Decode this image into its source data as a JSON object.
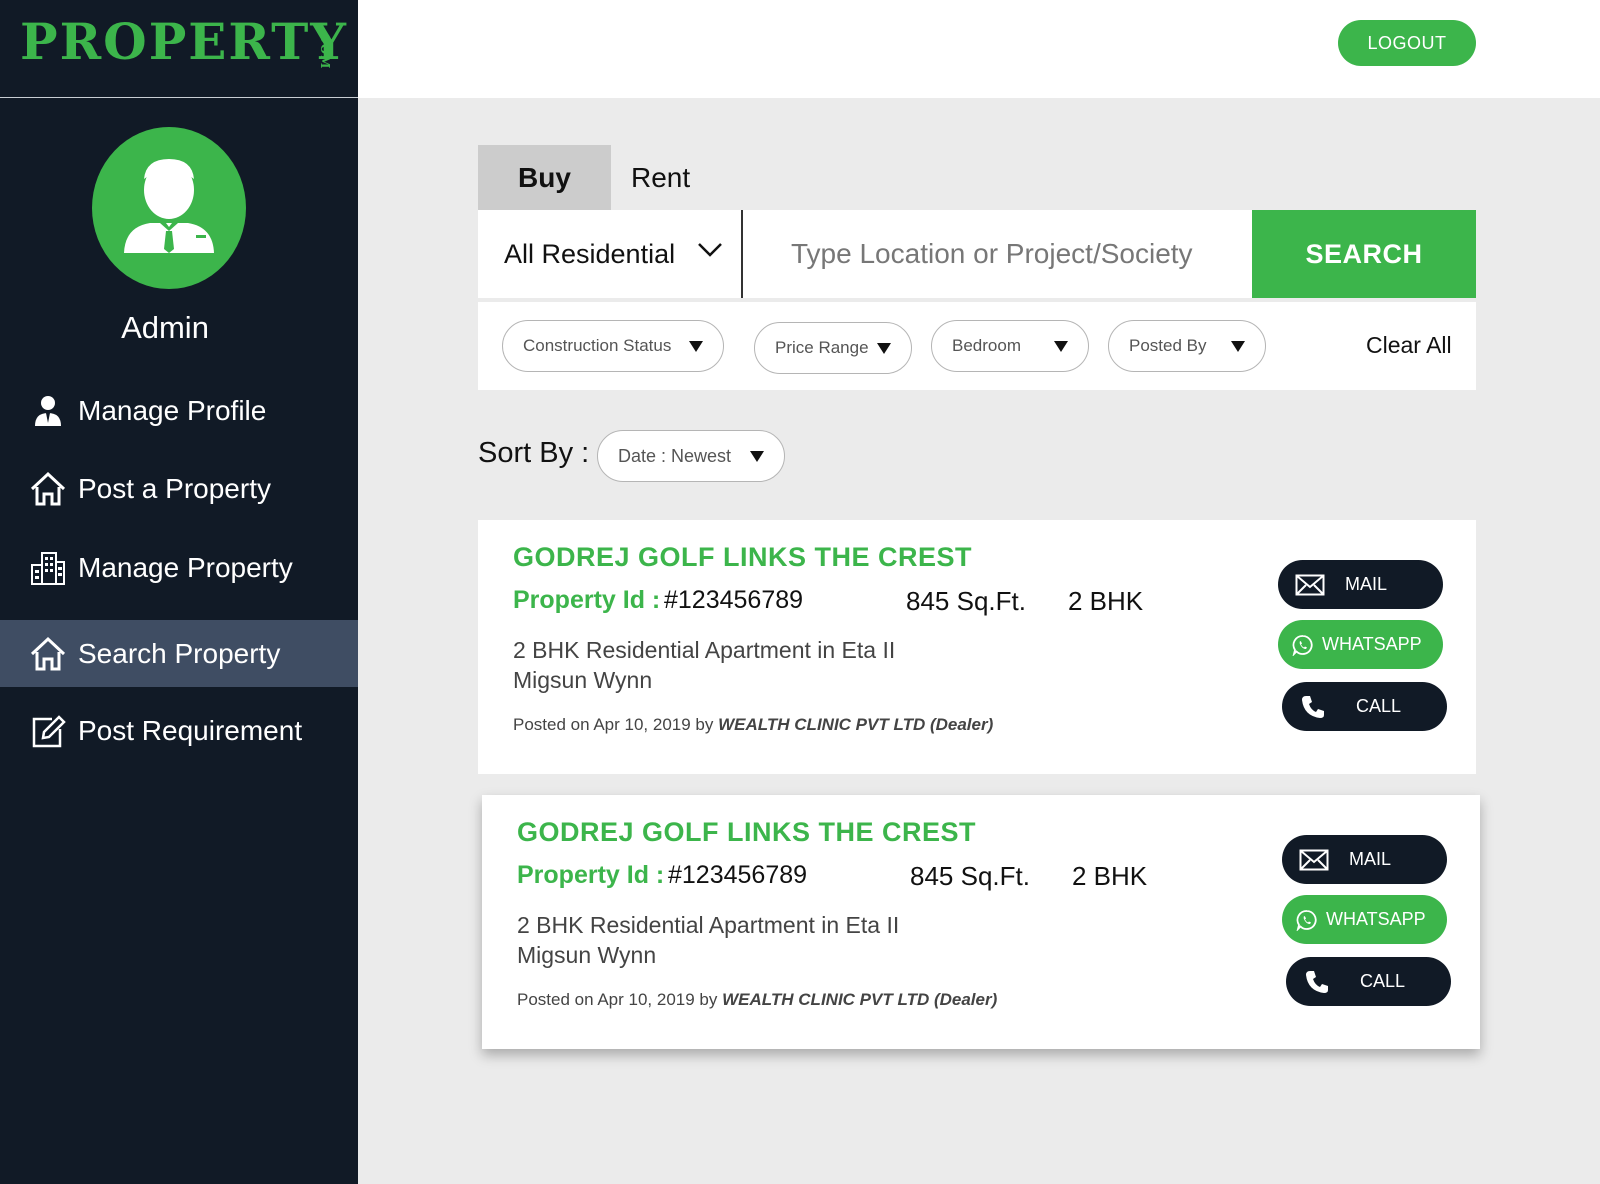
{
  "logo": {
    "text": "PROPERTY",
    "suffix": ".COM"
  },
  "sidebar": {
    "user_name": "Admin",
    "items": [
      {
        "label": "Manage Profile",
        "icon": "user-icon"
      },
      {
        "label": "Post a Property",
        "icon": "home-icon"
      },
      {
        "label": "Manage Property",
        "icon": "buildings-icon"
      },
      {
        "label": "Search Property",
        "icon": "home-icon",
        "active": true
      },
      {
        "label": "Post Requirement",
        "icon": "edit-icon"
      }
    ]
  },
  "header": {
    "logout_label": "LOGOUT"
  },
  "tabs": [
    {
      "label": "Buy",
      "active": true
    },
    {
      "label": "Rent",
      "active": false
    }
  ],
  "search": {
    "type_value": "All Residential",
    "placeholder": "Type Location or Project/Society",
    "button_label": "SEARCH"
  },
  "filters": {
    "items": [
      "Construction Status",
      "Price Range",
      "Bedroom",
      "Posted By"
    ],
    "clear_label": "Clear All"
  },
  "sort": {
    "label": "Sort By :",
    "value": "Date : Newest"
  },
  "listings": [
    {
      "title": "GODREJ GOLF LINKS THE CREST",
      "id_label": "Property Id :",
      "id_value": "#123456789",
      "area": "845 Sq.Ft.",
      "bhk": "2 BHK",
      "desc_line1": "2 BHK Residential Apartment in Eta II",
      "desc_line2": "Migsun Wynn",
      "posted_prefix": "Posted on Apr 10, 2019 by",
      "posted_by": "WEALTH CLINIC PVT LTD (Dealer)",
      "actions": {
        "mail": "MAIL",
        "whatsapp": "WHATSAPP",
        "call": "CALL"
      }
    },
    {
      "title": "GODREJ GOLF LINKS THE CREST",
      "id_label": "Property Id :",
      "id_value": "#123456789",
      "area": "845 Sq.Ft.",
      "bhk": "2 BHK",
      "desc_line1": "2 BHK Residential Apartment in Eta II",
      "desc_line2": "Migsun Wynn",
      "posted_prefix": "Posted on Apr 10, 2019 by",
      "posted_by": "WEALTH CLINIC PVT LTD (Dealer)",
      "actions": {
        "mail": "MAIL",
        "whatsapp": "WHATSAPP",
        "call": "CALL"
      }
    }
  ],
  "colors": {
    "accent": "#3cb54b",
    "sidebar": "#111a26",
    "sidebar_active": "#3f4d63",
    "background": "#ebebeb"
  }
}
